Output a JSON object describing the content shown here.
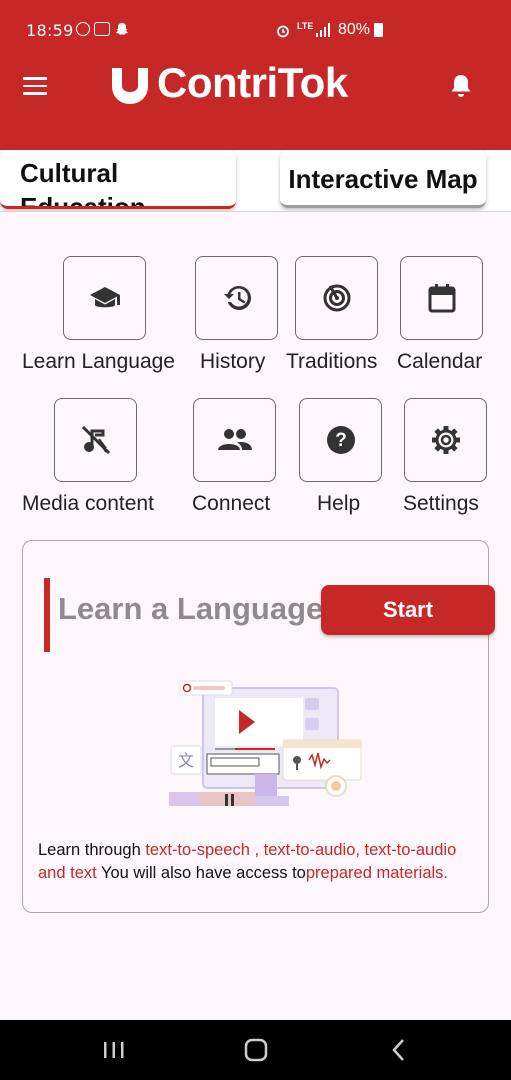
{
  "status_bar": {
    "time": "18:59",
    "battery": "80%",
    "network": "LTE"
  },
  "app_bar": {
    "title": "ContriTok",
    "menu_icon": "hamburger-menu-icon",
    "logo_icon": "u-magnet-logo",
    "notification_icon": "bell-icon",
    "brand_color": "#c62828"
  },
  "tabs": [
    {
      "label": "Cultural Education"
    },
    {
      "label": "Interactive Map"
    }
  ],
  "features": [
    {
      "label": "Learn Language",
      "icon": "school-cap-icon"
    },
    {
      "label": "History",
      "icon": "history-icon"
    },
    {
      "label": "Traditions",
      "icon": "radar-icon"
    },
    {
      "label": "Calendar",
      "icon": "calendar-icon"
    },
    {
      "label": "Media content",
      "icon": "music-off-icon"
    },
    {
      "label": "Connect",
      "icon": "people-icon"
    },
    {
      "label": "Help",
      "icon": "help-icon"
    },
    {
      "label": "Settings",
      "icon": "gear-icon"
    }
  ],
  "card": {
    "title": "Learn a Language",
    "button": "Start",
    "desc_1": "Learn through ",
    "desc_2": "text-to-speech , text-to-audio, text-to-audio and text",
    "desc_3": " You will also have access to",
    "desc_4": "prepared materials."
  },
  "nav": {
    "recent_icon": "recent-apps-icon",
    "home_icon": "home-icon",
    "back_icon": "back-icon"
  }
}
